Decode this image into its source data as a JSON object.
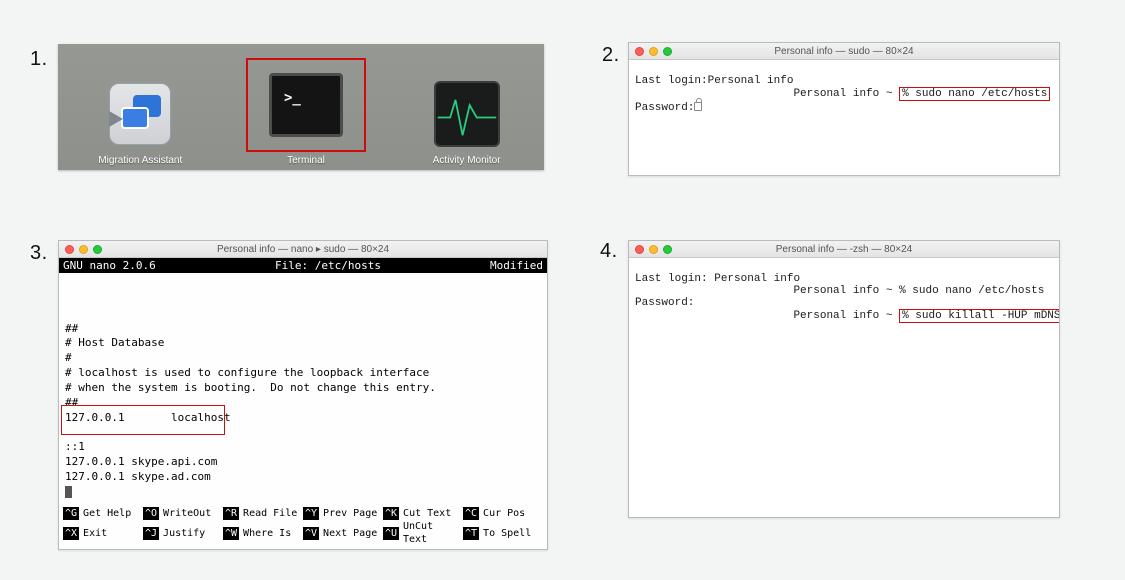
{
  "step_numbers": {
    "s1": "1.",
    "s2": "2.",
    "s3": "3.",
    "s4": "4."
  },
  "step1": {
    "items": [
      {
        "label": "Migration Assistant"
      },
      {
        "label": "Terminal"
      },
      {
        "label": "Activity Monitor"
      }
    ],
    "terminal_prompt_glyph": ">_"
  },
  "step2": {
    "title_user": "Personal info",
    "title_suffix": " — sudo — 80×24",
    "line1_label": "Last login:",
    "line1_value": "Personal info",
    "prompt_user": "Personal info",
    "prompt_sep": " ~ ",
    "command": "% sudo nano /etc/hosts",
    "password_label": "Password:"
  },
  "step3": {
    "title_user": "Personal info",
    "title_suffix": "  — nano ▸ sudo — 80×24",
    "nano_version": "GNU nano 2.0.6",
    "nano_file": "File: /etc/hosts",
    "nano_status": "Modified",
    "body_lines": [
      "##",
      "# Host Database",
      "#",
      "# localhost is used to configure the loopback interface",
      "# when the system is booting.  Do not change this entry.",
      "##",
      "127.0.0.1       localhost",
      "",
      "::1",
      "127.0.0.1 skype.api.com",
      "127.0.0.1 skype.ad.com"
    ],
    "shortcuts": [
      {
        "key": "^G",
        "label": "Get Help"
      },
      {
        "key": "^O",
        "label": "WriteOut"
      },
      {
        "key": "^R",
        "label": "Read File"
      },
      {
        "key": "^Y",
        "label": "Prev Page"
      },
      {
        "key": "^K",
        "label": "Cut Text"
      },
      {
        "key": "^C",
        "label": "Cur Pos"
      },
      {
        "key": "^X",
        "label": "Exit"
      },
      {
        "key": "^J",
        "label": "Justify"
      },
      {
        "key": "^W",
        "label": "Where Is"
      },
      {
        "key": "^V",
        "label": "Next Page"
      },
      {
        "key": "^U",
        "label": "UnCut Text"
      },
      {
        "key": "^T",
        "label": "To Spell"
      }
    ]
  },
  "step4": {
    "title_user": "Personal info",
    "title_suffix": "  — -zsh — 80×24",
    "line1_label": "Last login:",
    "line1_value": " Personal info",
    "password_label": "Password:",
    "prompt_user": "Personal info",
    "prompt_sep": " ~ ",
    "command1": "% sudo nano /etc/hosts",
    "command2": "% sudo killall -HUP mDNSResponder"
  }
}
